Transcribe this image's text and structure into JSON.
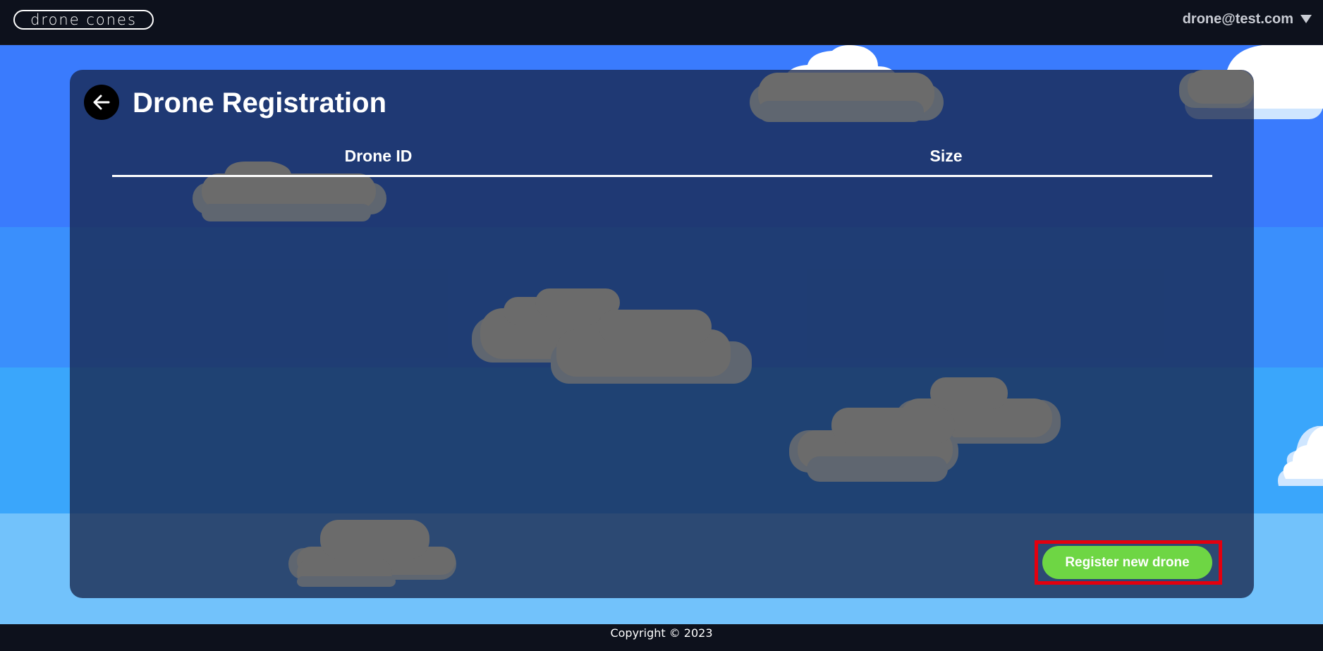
{
  "header": {
    "logo_text": "drone cones",
    "user_email": "drone@test.com",
    "user_menu_icon": "caret-down-icon"
  },
  "page": {
    "title": "Drone Registration",
    "back_icon": "arrow-left-icon"
  },
  "table": {
    "columns": [
      "Drone ID",
      "Size"
    ],
    "rows": []
  },
  "actions": {
    "register_label": "Register new drone"
  },
  "footer": {
    "copyright": "Copyright © 2023"
  },
  "colors": {
    "topbar": "#0d111c",
    "panel": "#18264d",
    "cta": "#6ed644",
    "highlight": "#e3000f"
  }
}
